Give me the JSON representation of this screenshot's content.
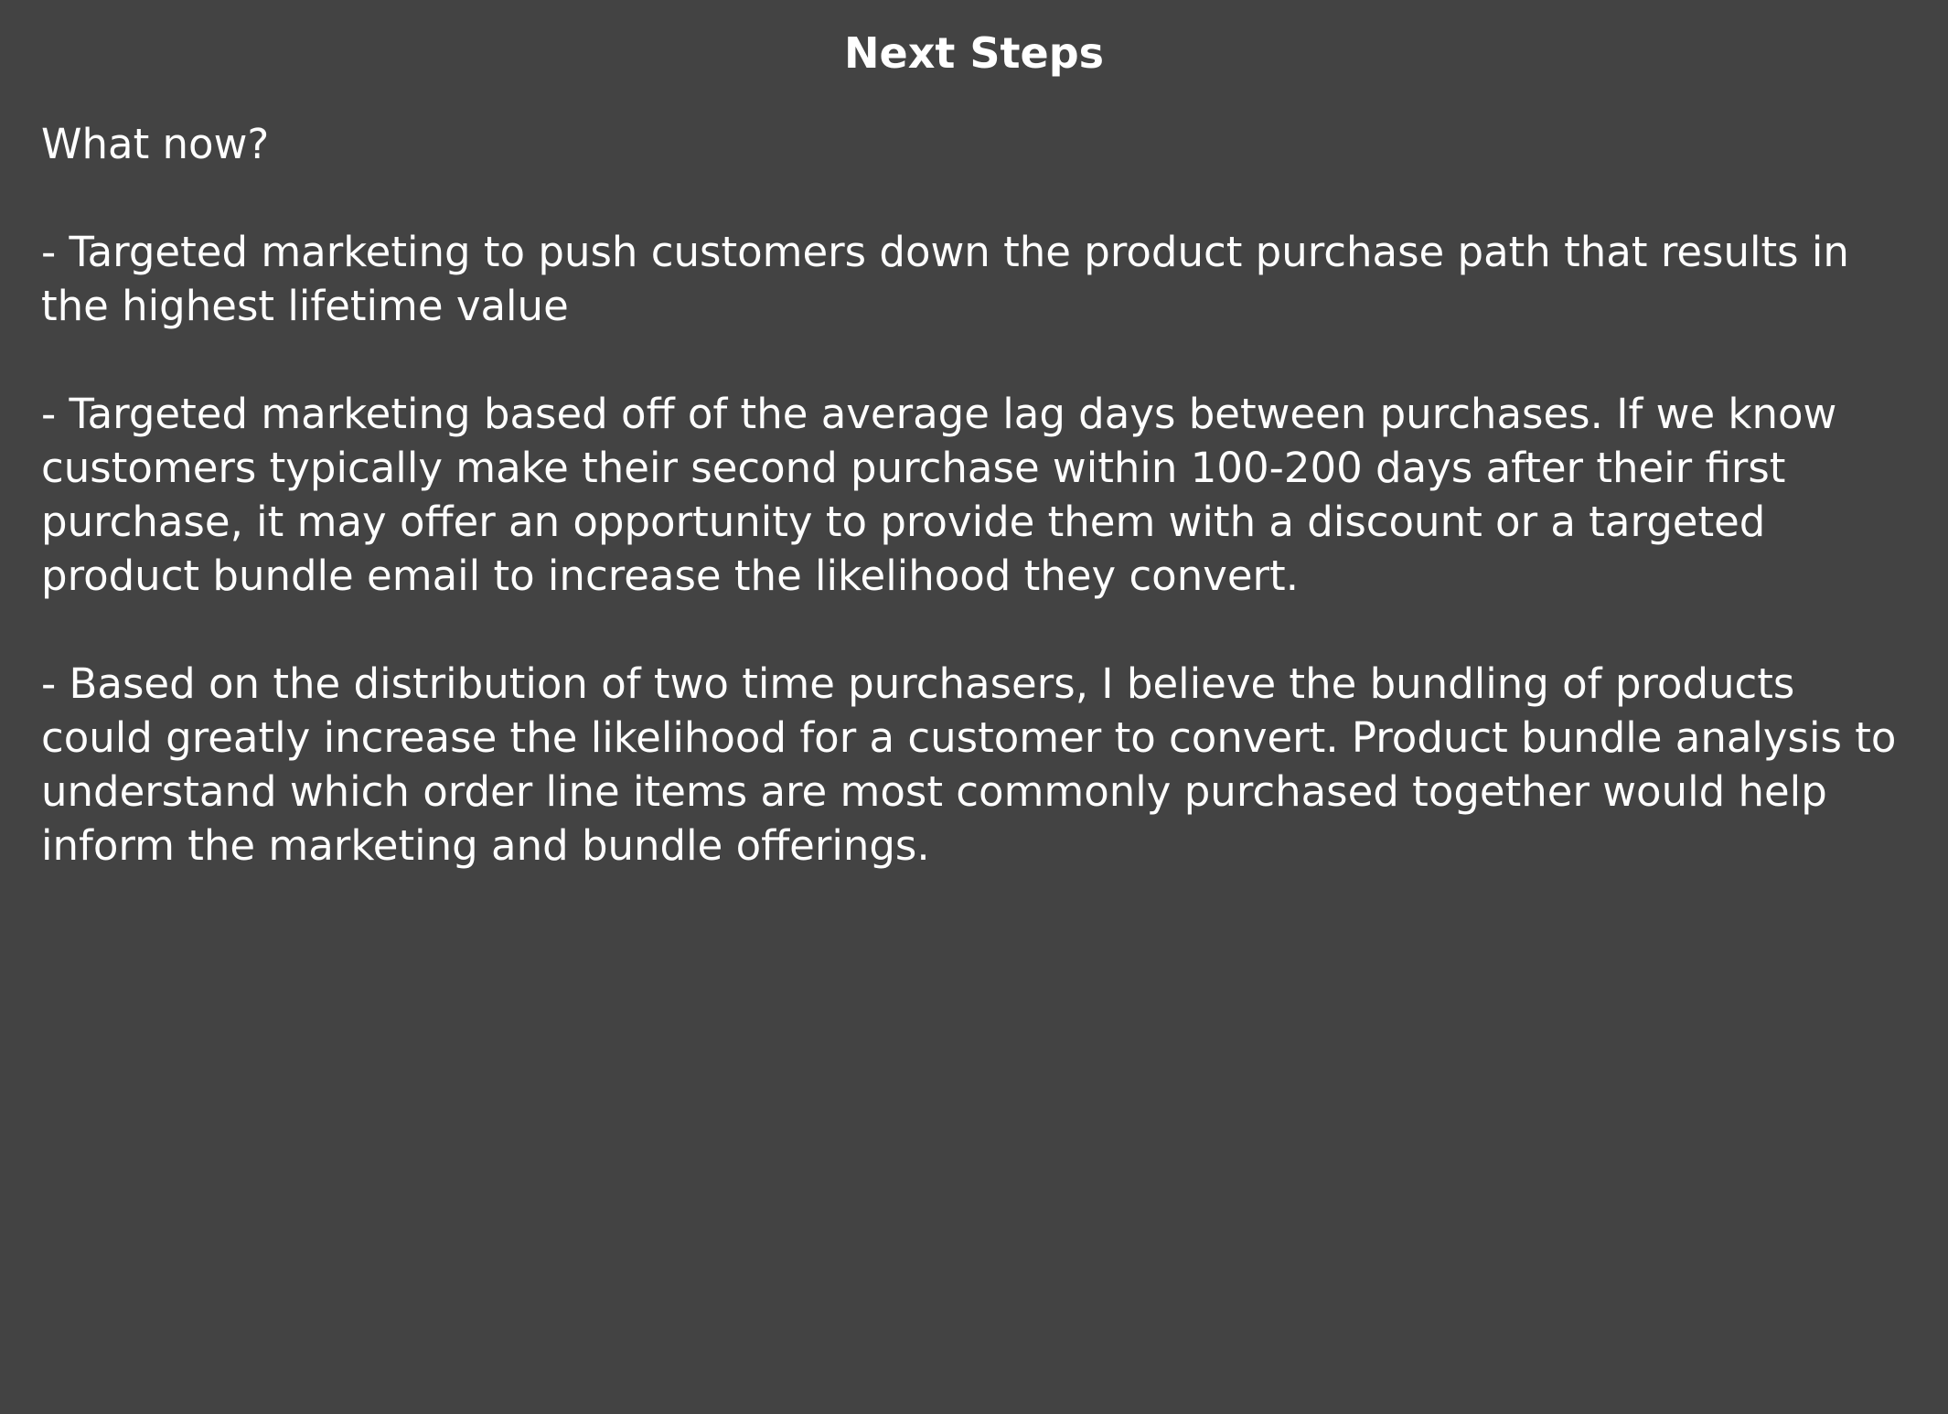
{
  "colors": {
    "background": "#434343",
    "text": "#ffffff"
  },
  "title": "Next Steps",
  "intro": "What now?",
  "bullets": [
    "- Targeted marketing to push customers down the product purchase path that results in the highest lifetime value",
    "- Targeted marketing based off of the average lag days between purchases. If we know customers typically make their second purchase within 100-200 days after their first purchase, it may offer an opportunity to provide them with a discount or a targeted product bundle email to increase the likelihood they convert.",
    "- Based on the distribution of two time purchasers, I believe the bundling of products could greatly increase the likelihood for a customer to convert. Product bundle analysis to understand which order line items are most commonly purchased together would help inform the marketing and bundle offerings."
  ]
}
